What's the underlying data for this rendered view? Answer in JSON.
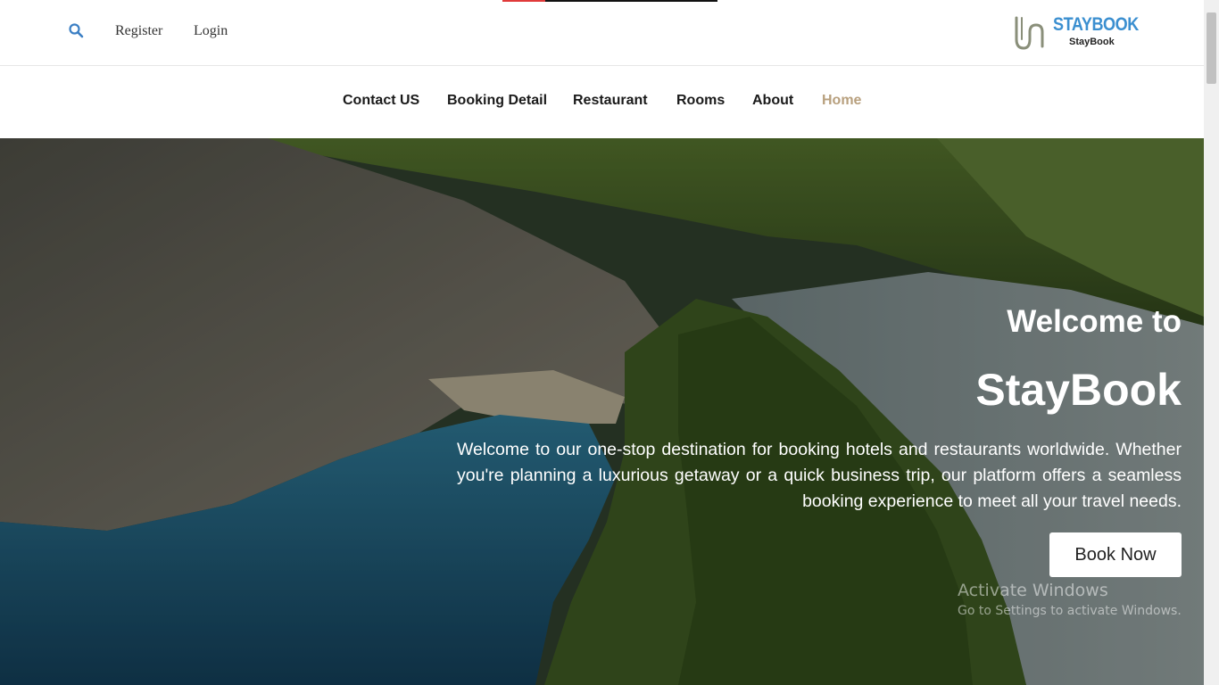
{
  "header": {
    "search_icon": "search-icon",
    "register": "Register",
    "login": "Login",
    "logo_title": "STAYBOOK",
    "logo_subtitle": "StayBook"
  },
  "nav": {
    "items": [
      {
        "label": "Contact US"
      },
      {
        "label": "Booking Detail"
      },
      {
        "label": "Restaurant"
      },
      {
        "label": "Rooms"
      },
      {
        "label": "About"
      },
      {
        "label": "Home",
        "active": true
      }
    ]
  },
  "hero": {
    "title_line1": "Welcome to",
    "title_line2": "StayBook",
    "description": "Welcome to our one-stop destination for booking hotels and restaurants worldwide. Whether you're planning a luxurious getaway or a quick business trip, our platform offers a seamless booking experience to meet all your travel needs.",
    "button": "Book Now"
  },
  "watermark": {
    "line1": "Activate Windows",
    "line2": "Go to Settings to activate Windows."
  },
  "colors": {
    "accent": "#b8a07e",
    "logo_blue": "#3b8fd0"
  }
}
